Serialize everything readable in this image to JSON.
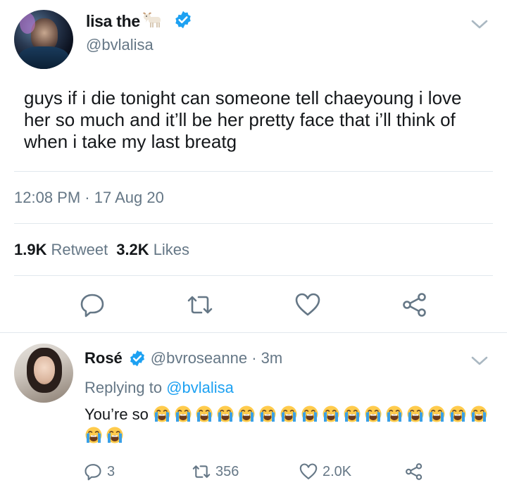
{
  "tweet": {
    "display_name": "lisa the",
    "name_emoji": "goat-icon",
    "handle": "@bvlalisa",
    "text": "guys if i die tonight can someone tell chaeyoung i love her so much and it’ll be her pretty face that i’ll think of when i take my last breatg",
    "timestamp": "12:08 PM · 17 Aug 20",
    "retweet_count": "1.9K",
    "retweet_label": "Retweet",
    "like_count": "3.2K",
    "like_label": "Likes"
  },
  "reply": {
    "display_name": "Rosé",
    "handle_time": "@bvroseanne · 3m",
    "replying_prefix": "Replying to",
    "replying_handle": "@bvlalisa",
    "text": "You’re so",
    "emoji_name": "loudly-crying-face-icon",
    "emoji_count": 18,
    "reply_count": "3",
    "retweet_count": "356",
    "like_count": "2.0K"
  },
  "colors": {
    "accent": "#1da1f2",
    "text_primary": "#14171a",
    "text_secondary": "#657786",
    "divider": "#e1e8ed",
    "emoji_face": "#ffcb4c",
    "tears": "#3aa0e6"
  },
  "icons": [
    "goat-icon",
    "verified-badge-icon",
    "chevron-down-icon",
    "reply-icon",
    "retweet-icon",
    "heart-icon",
    "share-icon"
  ]
}
